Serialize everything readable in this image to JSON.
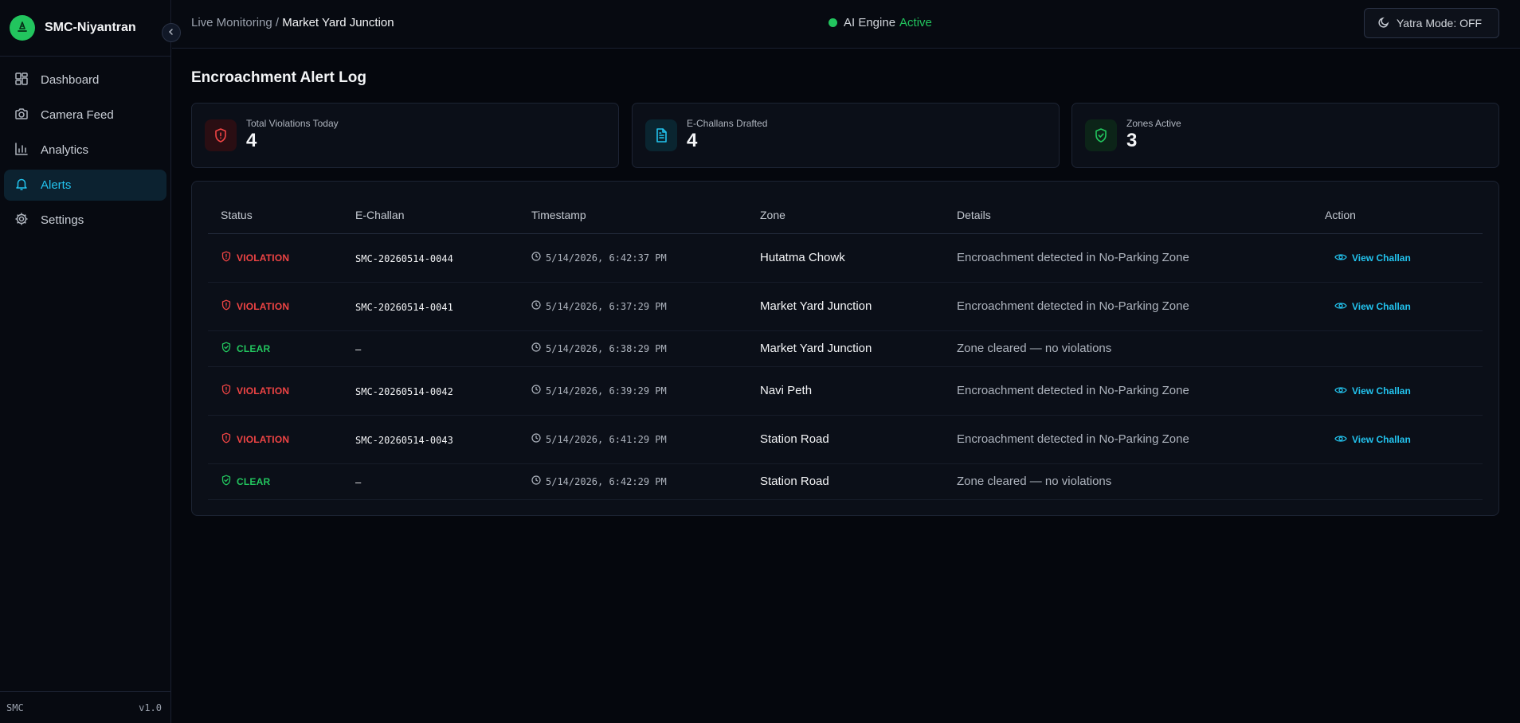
{
  "app": {
    "name": "SMC-Niyantran",
    "footer_left": "SMC",
    "version": "v1.0"
  },
  "sidebar": {
    "items": [
      {
        "label": "Dashboard",
        "icon": "dashboard-icon"
      },
      {
        "label": "Camera Feed",
        "icon": "camera-icon"
      },
      {
        "label": "Analytics",
        "icon": "bar-chart-icon"
      },
      {
        "label": "Alerts",
        "icon": "bell-icon",
        "active": true
      },
      {
        "label": "Settings",
        "icon": "gear-icon"
      }
    ]
  },
  "header": {
    "breadcrumb_root": "Live Monitoring",
    "breadcrumb_sep": "/",
    "breadcrumb_current": "Market Yard Junction",
    "engine_label": "AI Engine",
    "engine_status": "Active",
    "yatra_label": "Yatra Mode: OFF"
  },
  "page": {
    "title": "Encroachment Alert Log"
  },
  "stats": [
    {
      "label": "Total Violations Today",
      "value": "4"
    },
    {
      "label": "E-Challans Drafted",
      "value": "4"
    },
    {
      "label": "Zones Active",
      "value": "3"
    }
  ],
  "table": {
    "headers": [
      "Status",
      "E-Challan",
      "Timestamp",
      "Zone",
      "Details",
      "Action"
    ],
    "rows": [
      {
        "status": "VIOLATION",
        "challan": "SMC-20260514-0044",
        "timestamp": "5/14/2026, 6:42:37 PM",
        "zone": "Hutatma Chowk",
        "details": "Encroachment detected in No-Parking Zone",
        "action": "View Challan"
      },
      {
        "status": "VIOLATION",
        "challan": "SMC-20260514-0041",
        "timestamp": "5/14/2026, 6:37:29 PM",
        "zone": "Market Yard Junction",
        "details": "Encroachment detected in No-Parking Zone",
        "action": "View Challan"
      },
      {
        "status": "CLEAR",
        "challan": "–",
        "timestamp": "5/14/2026, 6:38:29 PM",
        "zone": "Market Yard Junction",
        "details": "Zone cleared — no violations",
        "action": ""
      },
      {
        "status": "VIOLATION",
        "challan": "SMC-20260514-0042",
        "timestamp": "5/14/2026, 6:39:29 PM",
        "zone": "Navi Peth",
        "details": "Encroachment detected in No-Parking Zone",
        "action": "View Challan"
      },
      {
        "status": "VIOLATION",
        "challan": "SMC-20260514-0043",
        "timestamp": "5/14/2026, 6:41:29 PM",
        "zone": "Station Road",
        "details": "Encroachment detected in No-Parking Zone",
        "action": "View Challan"
      },
      {
        "status": "CLEAR",
        "challan": "–",
        "timestamp": "5/14/2026, 6:42:29 PM",
        "zone": "Station Road",
        "details": "Zone cleared — no violations",
        "action": ""
      }
    ]
  },
  "colors": {
    "accent": "#22c3ee",
    "violation": "#ef4444",
    "clear": "#22c55e",
    "background": "#05070d"
  }
}
